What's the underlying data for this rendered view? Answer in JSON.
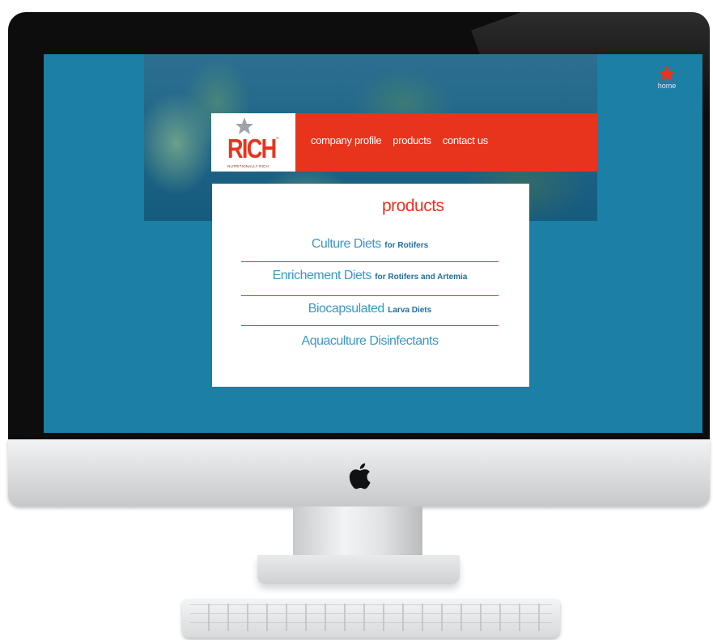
{
  "nav": {
    "home": "home",
    "links": [
      "company profile",
      "products",
      "contact us"
    ]
  },
  "logo": {
    "word": "RICH",
    "tagline": "NUTRITIONALLY RICH",
    "trademark": "™"
  },
  "panel": {
    "title": "products",
    "items": [
      {
        "main": "Culture Diets",
        "sub": "for Rotifers"
      },
      {
        "main": "Enrichement Diets",
        "sub": "for Rotifers and Artemia"
      },
      {
        "main": "Biocapsulated",
        "sub": "Larva Diets"
      },
      {
        "main": "Aquaculture Disinfectants",
        "sub": ""
      }
    ]
  },
  "colors": {
    "accent": "#e8341d",
    "screen_background": "#1b7fa6",
    "link_blue": "#3a98c8"
  },
  "icons": [
    "star-icon",
    "apple-logo-icon"
  ]
}
